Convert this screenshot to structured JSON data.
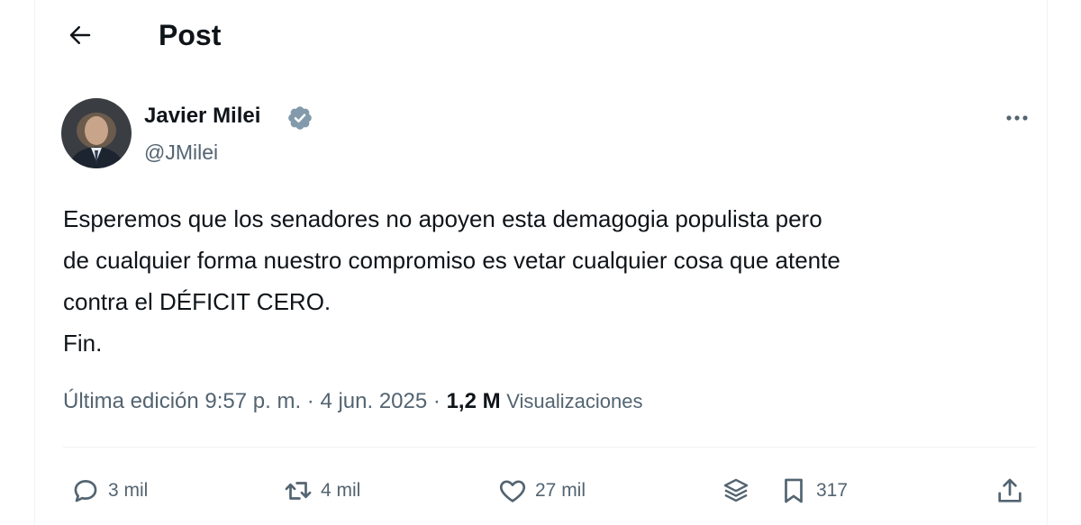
{
  "header": {
    "back_icon": "arrow-left-icon",
    "title": "Post"
  },
  "post": {
    "author": {
      "name": "Javier Milei",
      "handle": "@JMilei",
      "verified_icon": "verified-badge-icon",
      "verified_color": "#829aab"
    },
    "more_icon": "more-horizontal-icon",
    "text_lines": [
      "Esperemos que los senadores no apoyen esta demagogia populista pero",
      "de cualquier forma nuestro compromiso es vetar cualquier cosa que atente",
      "contra el DÉFICIT CERO.",
      "Fin."
    ],
    "meta": {
      "edited_time": "Última edición 9:57 p. m.",
      "separator": " · ",
      "date": "4 jun. 2025",
      "views_count": "1,2 M",
      "views_label": "Visualizaciones"
    },
    "actions": {
      "replies": {
        "icon": "reply-icon",
        "count": "3 mil"
      },
      "reposts": {
        "icon": "repost-icon",
        "count": "4 mil"
      },
      "likes": {
        "icon": "heart-icon",
        "count": "27 mil"
      },
      "grok": {
        "icon": "stack-icon"
      },
      "bookmarks": {
        "icon": "bookmark-icon",
        "count": "317"
      },
      "share": {
        "icon": "share-icon"
      }
    }
  },
  "colors": {
    "text_primary": "#0f1419",
    "text_secondary": "#536471",
    "divider": "#eff3f4"
  }
}
